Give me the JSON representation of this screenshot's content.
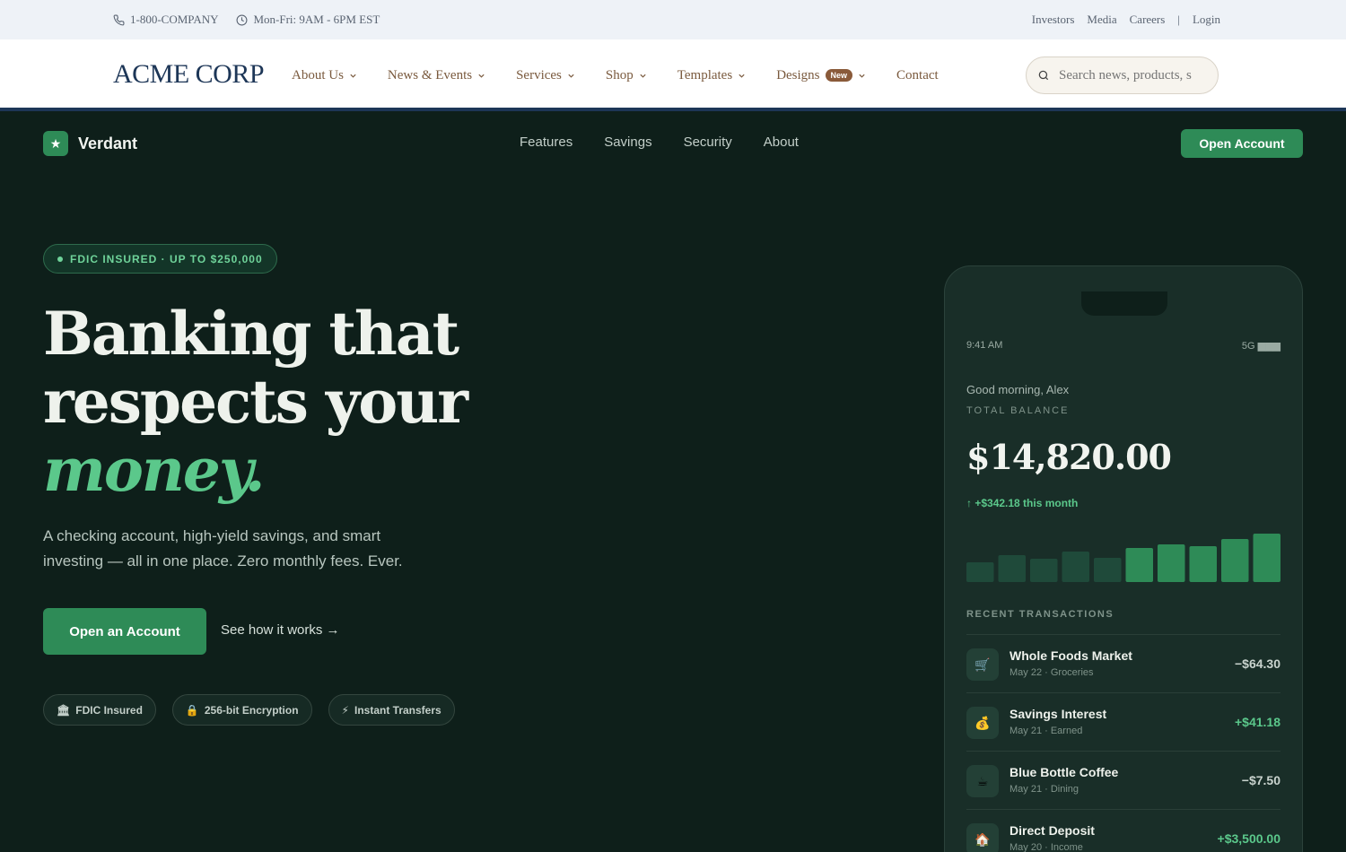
{
  "utility": {
    "phone": "1-800-COMPANY",
    "hours": "Mon-Fri: 9AM - 6PM EST",
    "links": [
      "Investors",
      "Media",
      "Careers"
    ],
    "separator": "|",
    "login": "Login"
  },
  "header": {
    "logo": "ACME CORP",
    "nav": [
      "About Us",
      "News & Events",
      "Services",
      "Shop",
      "Templates",
      "Designs",
      "Contact"
    ],
    "designs_badge": "New",
    "search_placeholder": "Search news, products, s"
  },
  "verdant": {
    "brand": "Verdant",
    "brand_icon": "star-icon",
    "links": [
      "Features",
      "Savings",
      "Security",
      "About"
    ],
    "cta": "Open Account",
    "pill": "FDIC INSURED · UP TO $250,000",
    "headline_1": "Banking that",
    "headline_2": "respects your",
    "headline_accent": "money.",
    "subtitle": "A checking account, high-yield savings, and smart investing — all in one place. Zero monthly fees. Ever.",
    "primary_button": "Open an Account",
    "link_button": "See how it works →",
    "chips": [
      {
        "icon": "🏛",
        "label": "FDIC Insured"
      },
      {
        "icon": "🔒",
        "label": "256-bit Encryption"
      },
      {
        "icon": "⚡",
        "label": "Instant Transfers"
      }
    ]
  },
  "phone": {
    "time": "9:41 AM",
    "signal": "5G ▆▆▆",
    "greeting": "Good morning, Alex",
    "balance_label": "TOTAL BALANCE",
    "balance": "$14,820.00",
    "delta": "↑ +$342.18 this month",
    "bar_levels": [
      0.4,
      0.55,
      0.48,
      0.62,
      0.5,
      0.7,
      0.78,
      0.74,
      0.88,
      1.0
    ],
    "bar_colors": [
      "#1f4a3a",
      "#1f4a3a",
      "#1f4a3a",
      "#1f4a3a",
      "#1f4a3a",
      "#2e8b57",
      "#2e8b57",
      "#2e8b57",
      "#2e8b57",
      "#2e8b57"
    ],
    "recent_label": "RECENT TRANSACTIONS",
    "transactions": [
      {
        "icon": "🛒",
        "name": "Whole Foods Market",
        "meta": "May 22 · Groceries",
        "amount": "−$64.30",
        "positive": false
      },
      {
        "icon": "💰",
        "name": "Savings Interest",
        "meta": "May 21 · Earned",
        "amount": "+$41.18",
        "positive": true
      },
      {
        "icon": "☕",
        "name": "Blue Bottle Coffee",
        "meta": "May 21 · Dining",
        "amount": "−$7.50",
        "positive": false
      },
      {
        "icon": "🏠",
        "name": "Direct Deposit",
        "meta": "May 20 · Income",
        "amount": "+$3,500.00",
        "positive": true
      }
    ]
  }
}
